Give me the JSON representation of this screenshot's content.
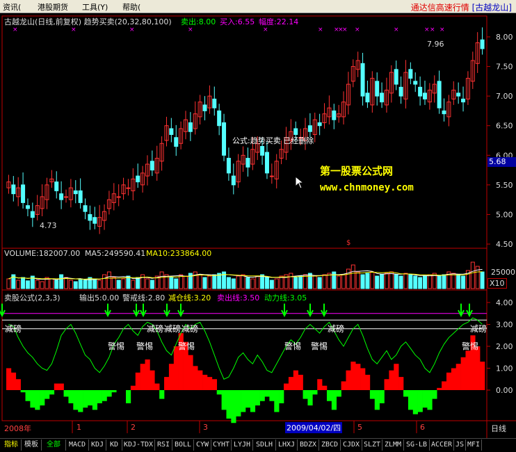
{
  "menubar": {
    "items": [
      "资讯(",
      "港股期货",
      "工具(Y)",
      "帮助("
    ],
    "brand": "通达信高速行情",
    "brand_link": "[古越龙山]"
  },
  "main_chart": {
    "title": "古越龙山(日线,前复权) 趋势买卖(20,32,80,100)",
    "sell_label": "卖出:8.00",
    "buy_label": "买入:6.55",
    "range_label": "幅度:22.14",
    "high_marker": "7.96",
    "low_marker": "4.73",
    "notice": "公式:趋势买卖 已经删除",
    "watermark_cn": "第一股票公式网",
    "watermark_url": "www.chnmoney.com",
    "price_tag": "5.68",
    "y_ticks": [
      "8.00",
      "7.50",
      "7.00",
      "6.50",
      "6.00",
      "5.50",
      "5.00",
      "4.50"
    ],
    "dollar_mark": "$"
  },
  "volume_panel": {
    "volume_label": "VOLUME:182007.00",
    "ma5_label": "MA5:249590.41",
    "ma10_label": "MA10:233864.00",
    "tick": "25000",
    "unit": "X10"
  },
  "indicator_panel": {
    "title": "卖股公式(2,3,3)",
    "out_label": "输出5:0.00",
    "warn_label": "警戒线:2.80",
    "reduce_label": "减仓线:3.20",
    "sell_label": "卖出线:3.50",
    "power_label": "动力线:3.05",
    "y_ticks": [
      "4.00",
      "3.00",
      "2.00",
      "1.00",
      "0.00"
    ],
    "labels": {
      "reduce": "减磅",
      "warn": "警惕"
    }
  },
  "x_axis": {
    "year": "2008年",
    "months": [
      "1",
      "2",
      "3",
      "5",
      "6"
    ],
    "date_box": "2009/04/02/四",
    "period": "日线"
  },
  "tabs": [
    "指标",
    "模板",
    "全部",
    "MACD",
    "KDJ",
    "KD",
    "KDJ-TDX",
    "RSI",
    "BOLL",
    "CYW",
    "CYHT",
    "LYJH",
    "SDLH",
    "LHXJ",
    "BDZX",
    "ZBCD",
    "CJDX",
    "SLZT",
    "ZLMM",
    "SG-LB",
    "ACCER",
    "JS",
    "MFI"
  ],
  "colors": {
    "up": "#ff3232",
    "down": "#54ffff",
    "indicator_pos": "#ff0000",
    "indicator_neg": "#00ff00",
    "purple_line": "#ff00ff",
    "axis": "#c00000"
  },
  "prices": [
    5.55,
    5.35,
    5.45,
    5.2,
    5.1,
    4.95,
    5.15,
    5.3,
    5.5,
    5.6,
    5.4,
    5.25,
    5.3,
    5.45,
    5.35,
    5.2,
    5.05,
    4.9,
    4.85,
    4.95,
    5.05,
    5.25,
    5.35,
    5.3,
    5.5,
    5.45,
    5.6,
    5.55,
    5.7,
    5.85,
    5.75,
    5.95,
    6.2,
    6.5,
    6.35,
    6.15,
    6.45,
    6.6,
    6.4,
    6.7,
    6.9,
    6.75,
    7.0,
    6.8,
    6.5,
    6.0,
    5.7,
    5.5,
    5.9,
    6.0,
    5.8,
    6.1,
    6.2,
    6.0,
    5.7,
    5.65,
    5.9,
    6.1,
    6.3,
    6.4,
    6.35,
    6.3,
    6.45,
    6.4,
    6.6,
    6.5,
    6.7,
    6.8,
    6.6,
    6.7,
    6.9,
    7.2,
    7.5,
    7.6,
    7.0,
    6.9,
    7.3,
    7.0,
    6.9,
    7.1,
    7.4,
    7.2,
    7.0,
    7.4,
    7.3,
    7.2,
    7.0,
    6.95,
    7.1,
    7.2,
    6.8,
    6.7,
    6.9,
    7.1,
    7.0,
    6.9,
    7.3,
    7.6,
    7.9,
    7.8
  ],
  "osc": [
    3.0,
    2.9,
    2.4,
    2.0,
    1.7,
    1.5,
    1.2,
    1.0,
    0.9,
    1.2,
    1.8,
    2.5,
    2.8,
    3.0,
    2.6,
    2.1,
    1.6,
    1.4,
    1.0,
    0.8,
    1.1,
    1.5,
    2.1,
    2.4,
    2.8,
    3.0,
    2.7,
    2.5,
    2.9,
    3.1,
    3.0,
    2.7,
    2.2,
    1.8,
    1.6,
    2.1,
    2.6,
    3.0,
    2.8,
    3.0,
    3.1,
    2.7,
    2.2,
    1.6,
    1.0,
    0.5,
    0.6,
    1.0,
    1.5,
    1.7,
    1.4,
    1.2,
    1.6,
    1.3,
    0.9,
    0.8,
    1.2,
    1.6,
    2.0,
    2.3,
    2.1,
    2.4,
    2.8,
    3.0,
    2.8,
    2.6,
    2.9,
    3.1,
    2.7,
    2.3,
    2.0,
    2.4,
    2.8,
    3.0,
    2.5,
    1.9,
    1.4,
    1.2,
    1.5,
    1.8,
    1.4,
    1.6,
    2.0,
    2.2,
    1.9,
    1.6,
    1.4,
    1.0,
    0.8,
    1.2,
    1.7,
    2.1,
    2.4,
    2.6,
    2.8,
    3.0,
    3.1,
    3.3,
    3.2,
    3.0
  ],
  "bars": [
    1.0,
    0.8,
    0.5,
    -0.1,
    -0.5,
    -0.8,
    -0.9,
    -0.7,
    -0.4,
    -0.2,
    0.3,
    0.3,
    -0.3,
    -0.6,
    -0.9,
    -1.0,
    -0.8,
    -0.7,
    -0.9,
    -0.6,
    -0.5,
    -0.3,
    -0.1,
    0.0,
    0.0,
    -0.6,
    0.2,
    0.8,
    1.2,
    1.4,
    0.9,
    0.3,
    -0.4,
    0.6,
    1.2,
    2.0,
    2.6,
    2.2,
    1.6,
    1.1,
    0.9,
    0.7,
    0.6,
    0.5,
    -0.2,
    -0.9,
    -1.3,
    -1.5,
    -1.2,
    -1.0,
    -0.8,
    -1.0,
    -0.7,
    -0.5,
    -0.3,
    -0.5,
    -1.0,
    -0.6,
    0.3,
    0.6,
    0.9,
    0.7,
    -0.4,
    -0.7,
    -0.2,
    0.5,
    0.2,
    -0.5,
    -0.9,
    -0.3,
    0.4,
    0.9,
    1.3,
    1.2,
    1.0,
    0.7,
    -0.4,
    -0.9,
    -0.6,
    0.5,
    0.9,
    1.2,
    0.6,
    -0.3,
    -0.9,
    -1.1,
    -1.0,
    -0.8,
    -0.9,
    -0.4,
    0.1,
    0.4,
    0.8,
    1.0,
    1.2,
    1.5,
    1.8,
    2.5,
    2.0,
    1.3
  ],
  "volumes": [
    0.35,
    0.5,
    0.3,
    0.4,
    0.28,
    0.45,
    0.3,
    0.25,
    0.4,
    0.35,
    0.3,
    0.5,
    0.4,
    0.3,
    0.25,
    0.35,
    0.3,
    0.4,
    0.35,
    0.3,
    0.5,
    0.6,
    0.4,
    0.3,
    0.35,
    0.45,
    0.3,
    0.4,
    0.5,
    0.35,
    0.3,
    0.45,
    0.6,
    0.5,
    0.4,
    0.35,
    0.5,
    0.45,
    0.55,
    0.6,
    0.5,
    0.4,
    0.45,
    0.5,
    0.55,
    0.6,
    0.4,
    0.35,
    0.45,
    0.5,
    0.4,
    0.35,
    0.45,
    0.5,
    0.4,
    0.3,
    0.35,
    0.45,
    0.5,
    0.55,
    0.4,
    0.45,
    0.5,
    0.55,
    0.45,
    0.4,
    0.5,
    0.55,
    0.6,
    0.45,
    0.5,
    0.7,
    0.85,
    0.6,
    0.5,
    0.55,
    0.6,
    0.45,
    0.5,
    0.55,
    0.6,
    0.5,
    0.45,
    0.55,
    0.5,
    0.45,
    0.4,
    0.45,
    0.5,
    0.55,
    0.45,
    0.5,
    0.6,
    0.55,
    0.5,
    0.45,
    0.65,
    0.95,
    0.8,
    0.6
  ]
}
